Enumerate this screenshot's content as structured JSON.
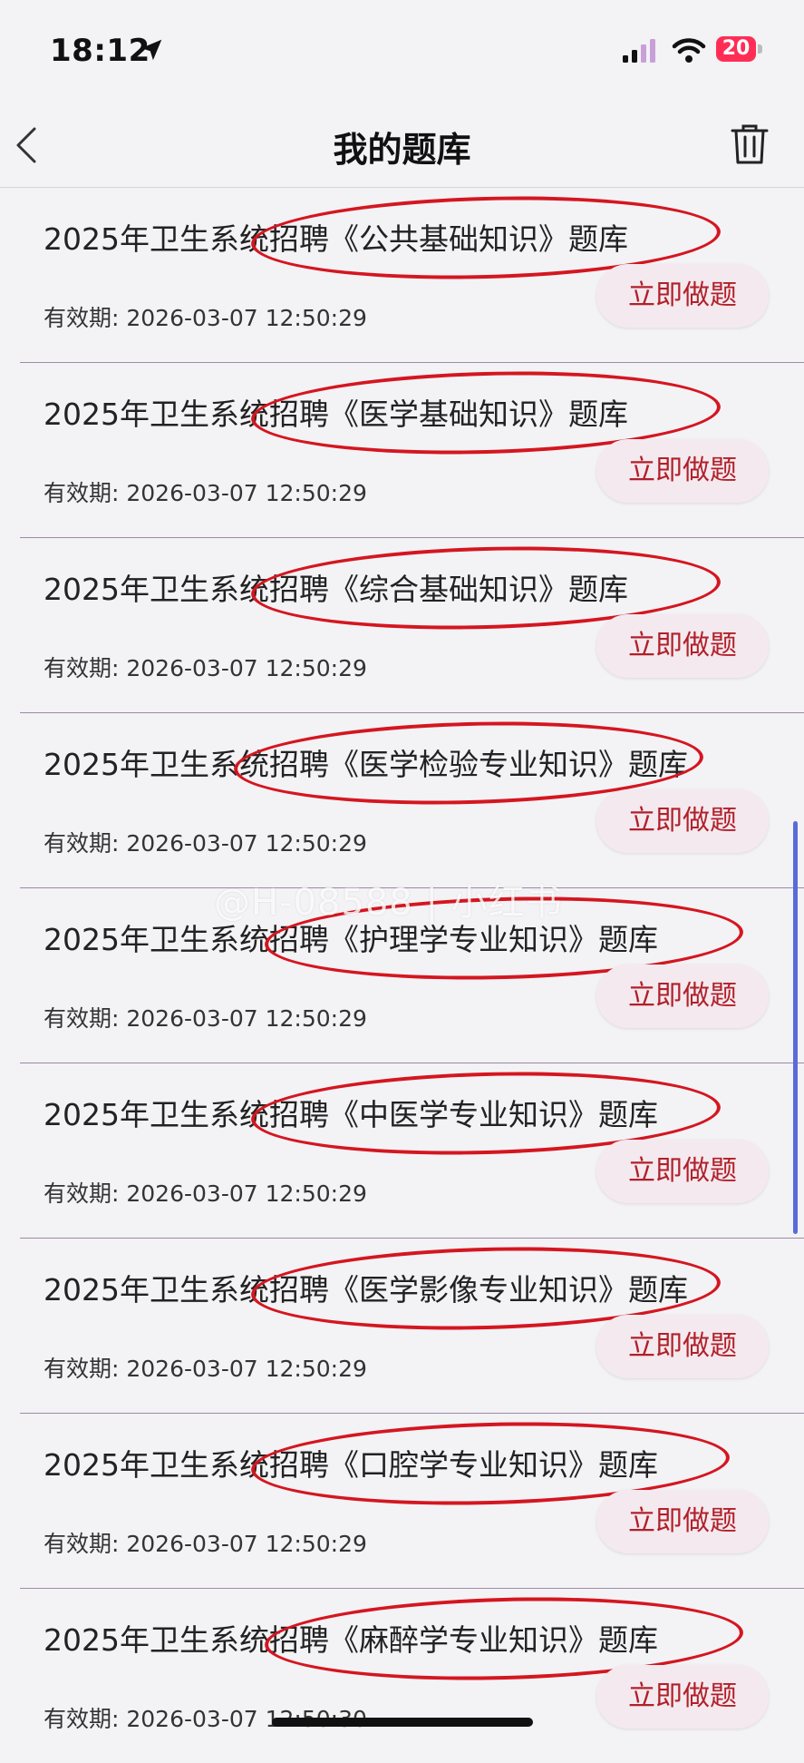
{
  "status": {
    "time": "18:12",
    "battery": "20",
    "icons": [
      "location-arrow-icon",
      "signal-icon",
      "wifi-icon",
      "battery-icon"
    ]
  },
  "nav": {
    "title": "我的题库",
    "back_icon": "chevron-left-icon",
    "delete_icon": "trash-icon"
  },
  "items": [
    {
      "title": "2025年卫生系统招聘《公共基础知识》题库",
      "date": "有效期: 2026-03-07 12:50:29",
      "button": "立即做题"
    },
    {
      "title": "2025年卫生系统招聘《医学基础知识》题库",
      "date": "有效期: 2026-03-07 12:50:29",
      "button": "立即做题"
    },
    {
      "title": "2025年卫生系统招聘《综合基础知识》题库",
      "date": "有效期: 2026-03-07 12:50:29",
      "button": "立即做题"
    },
    {
      "title": "2025年卫生系统招聘《医学检验专业知识》题库",
      "date": "有效期: 2026-03-07 12:50:29",
      "button": "立即做题"
    },
    {
      "title": "2025年卫生系统招聘《护理学专业知识》题库",
      "date": "有效期: 2026-03-07 12:50:29",
      "button": "立即做题"
    },
    {
      "title": "2025年卫生系统招聘《中医学专业知识》题库",
      "date": "有效期: 2026-03-07 12:50:29",
      "button": "立即做题"
    },
    {
      "title": "2025年卫生系统招聘《医学影像专业知识》题库",
      "date": "有效期: 2026-03-07 12:50:29",
      "button": "立即做题"
    },
    {
      "title": "2025年卫生系统招聘《口腔学专业知识》题库",
      "date": "有效期: 2026-03-07 12:50:29",
      "button": "立即做题"
    },
    {
      "title": "2025年卫生系统招聘《麻醉学专业知识》题库",
      "date": "有效期: 2026-03-07 12:50:30",
      "button": "立即做题"
    }
  ],
  "watermark": "@H-08588 | 小红书",
  "colors": {
    "accent": "#b0202a",
    "annotation": "#d41620",
    "divider": "#9d8aa8",
    "button_bg": "#f4e9ee"
  }
}
